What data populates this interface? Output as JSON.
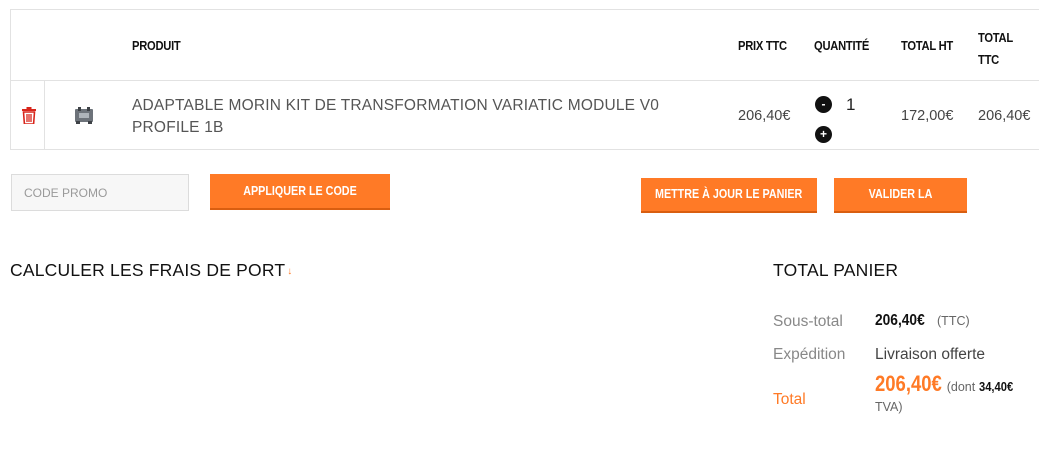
{
  "cart": {
    "headers": {
      "product": "PRODUIT",
      "price_ttc": "PRIX TTC",
      "quantity": "QUANTITÉ",
      "total_ht": "TOTAL HT",
      "total_ttc": "TOTAL TTC"
    },
    "items": [
      {
        "name": "ADAPTABLE MORIN KIT DE TRANSFORMATION VARIATIC MODULE V0 PROFILE 1B",
        "price_ttc": "206,40€",
        "quantity": "1",
        "total_ht": "172,00€",
        "total_ttc": "206,40€",
        "delete_icon": "trash-icon",
        "thumbnail_icon": "product-thumbnail"
      }
    ],
    "minus_label": "-",
    "plus_label": "+"
  },
  "actions": {
    "promo_placeholder": "CODE PROMO",
    "apply_promo": "APPLIQUER LE CODE PROMO",
    "update_cart": "METTRE À JOUR LE PANIER",
    "validate_order": "VALIDER LA COMMANDE"
  },
  "shipping": {
    "title": "CALCULER LES FRAIS DE PORT",
    "arrow": "↓"
  },
  "totals": {
    "title": "TOTAL PANIER",
    "subtotal_label": "Sous-total",
    "subtotal_value": "206,40€",
    "subtotal_note": "(TTC)",
    "shipping_label": "Expédition",
    "shipping_value": "Livraison offerte",
    "total_label": "Total",
    "total_value": "206,40€",
    "total_note_prefix": "(dont",
    "total_tva_value": "34,40€",
    "total_note_suffix": "TVA)"
  },
  "colors": {
    "accent": "#ff7a26",
    "delete": "#d9261c"
  }
}
